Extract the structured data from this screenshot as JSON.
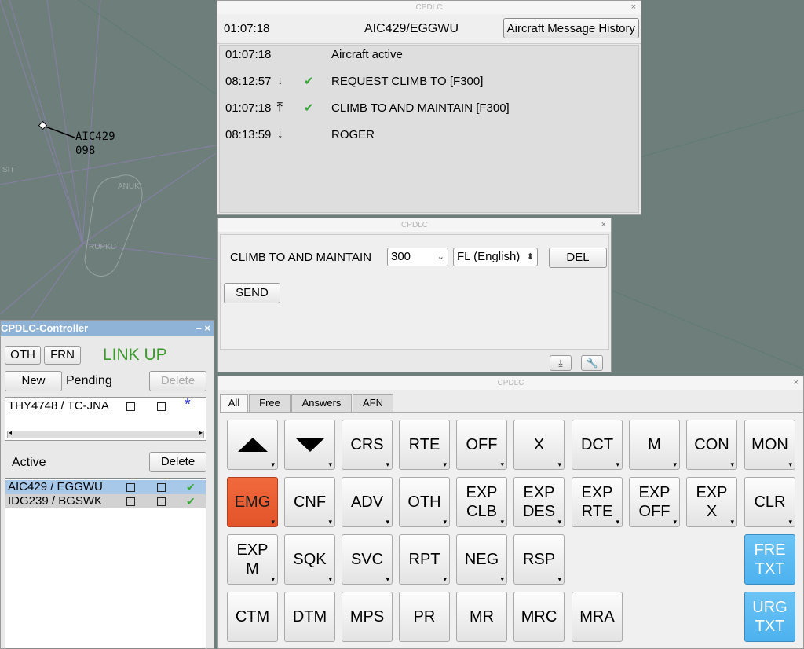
{
  "radar": {
    "aircraft_callsign": "AIC429",
    "aircraft_level": "098",
    "fix_left": "SIT",
    "fix_rupku": "RUPKU",
    "fix_anuki": "ANUKI"
  },
  "history_window": {
    "title": "CPDLC",
    "time": "01:07:18",
    "callsign": "AIC429/EGGWU",
    "history_button": "Aircraft Message History",
    "messages": [
      {
        "time": "01:07:18",
        "direction": "",
        "status": "",
        "text": "Aircraft active"
      },
      {
        "time": "08:12:57",
        "direction": "down",
        "status": "ok",
        "text": "REQUEST CLIMB TO [F300]"
      },
      {
        "time": "01:07:18",
        "direction": "up",
        "status": "ok",
        "text": "CLIMB TO AND MAINTAIN [F300]"
      },
      {
        "time": "08:13:59",
        "direction": "down",
        "status": "",
        "text": "ROGER"
      }
    ]
  },
  "compose_window": {
    "title": "CPDLC",
    "label": "CLIMB TO AND MAINTAIN",
    "level_value": "300",
    "unit_value": "FL (English)",
    "del_label": "DEL",
    "send_label": "SEND"
  },
  "controller": {
    "title": "CPDLC-Controller",
    "oth_label": "OTH",
    "frn_label": "FRN",
    "link_status": "LINK UP",
    "link_color": "#3a9a2a",
    "new_label": "New",
    "pending_label": "Pending",
    "pending_delete_label": "Delete",
    "pending_rows": [
      {
        "name": "THY4748 / TC-JNA"
      }
    ],
    "active_label": "Active",
    "active_delete_label": "Delete",
    "active_rows": [
      {
        "name": "AIC429 / EGGWU"
      },
      {
        "name": "IDG239 / BGSWK"
      }
    ]
  },
  "keys_window": {
    "title": "CPDLC",
    "tabs": [
      "All",
      "Free",
      "Answers",
      "AFN"
    ],
    "rows": [
      [
        "▲",
        "▼",
        "CRS",
        "RTE",
        "OFF",
        "X",
        "DCT",
        "M",
        "CON",
        "MON"
      ],
      [
        "EMG",
        "CNF",
        "ADV",
        "OTH",
        "EXP\nCLB",
        "EXP\nDES",
        "EXP\nRTE",
        "EXP\nOFF",
        "EXP\nX",
        "CLR"
      ],
      [
        "EXP\nM",
        "SQK",
        "SVC",
        "RPT",
        "NEG",
        "RSP",
        "FRE\nTXT"
      ],
      [
        "CTM",
        "DTM",
        "MPS",
        "PR",
        "MR",
        "MRC",
        "MRA",
        "URG\nTXT"
      ]
    ],
    "accent_red": "#e3532a",
    "accent_blue": "#4cb2ee"
  }
}
